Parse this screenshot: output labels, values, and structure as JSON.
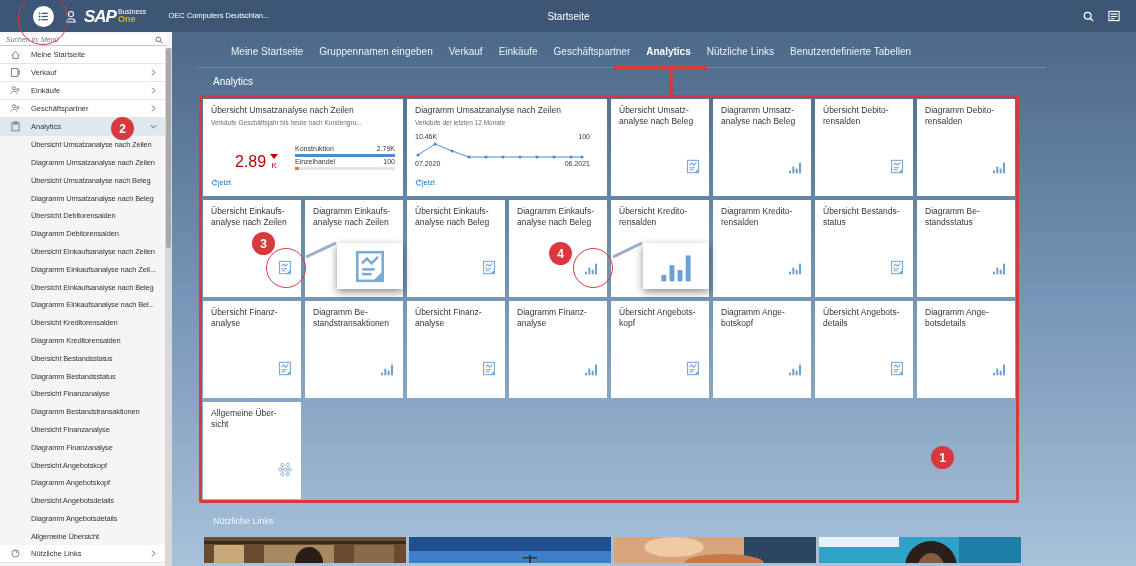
{
  "top_bar": {
    "logo": {
      "brand": "SAP",
      "line_1": "Business",
      "line_2": "One"
    },
    "company": "OEC Computers Deutschlan...",
    "title": "Startseite"
  },
  "sidebar": {
    "search": {
      "placeholder": "Suchen in: Menü"
    },
    "items": [
      {
        "label": "Meine Startseite",
        "kind": "page",
        "selected": false
      },
      {
        "label": "Verkauf",
        "kind": "group",
        "expanded": false,
        "selected": false
      },
      {
        "label": "Einkäufe",
        "kind": "group",
        "expanded": false,
        "selected": false
      },
      {
        "label": "Geschäftspartner",
        "kind": "group",
        "expanded": false,
        "selected": false
      },
      {
        "label": "Analytics",
        "kind": "group",
        "expanded": true,
        "selected": true,
        "children": [
          {
            "label": "Übersicht Umsatzanalyse nach Zeilen",
            "selected": false
          },
          {
            "label": "Diagramm Umsatzanalyse nach Zeilen",
            "selected": false
          },
          {
            "label": "Übersicht Umsatzanalyse nach Beleg",
            "selected": false
          },
          {
            "label": "Diagramm Umsatzanalyse nach Beleg",
            "selected": false
          },
          {
            "label": "Übersicht Debitorensalden",
            "selected": false
          },
          {
            "label": "Diagramm Debitorensalden",
            "selected": false
          },
          {
            "label": "Übersicht Einkaufsanalyse nach Zeilen",
            "selected": false
          },
          {
            "label": "Diagramm Einkaufsanalyse nach Zeil...",
            "selected": false
          },
          {
            "label": "Übersicht Einkaufsanalyse nach Beleg",
            "selected": false
          },
          {
            "label": "Diagramm Einkaufsanalyse nach Bel...",
            "selected": false
          },
          {
            "label": "Übersicht Kreditorensalden",
            "selected": false
          },
          {
            "label": "Diagramm Kreditorensalden",
            "selected": false
          },
          {
            "label": "Übersicht Bestandsstatus",
            "selected": false
          },
          {
            "label": "Diagramm Bestandsstatus",
            "selected": false
          },
          {
            "label": "Übersicht Finanzanalyse",
            "selected": false
          },
          {
            "label": "Diagramm Bestandstransaktionen",
            "selected": false
          },
          {
            "label": "Übersicht Finanzanalyse",
            "selected": false
          },
          {
            "label": "Diagramm Finanzanalyse",
            "selected": false
          },
          {
            "label": "Übersicht Angebotskopf",
            "selected": false
          },
          {
            "label": "Diagramm Angebotskopf",
            "selected": false
          },
          {
            "label": "Übersicht Angebotsdetails",
            "selected": false
          },
          {
            "label": "Diagramm Angebotsdetails",
            "selected": false
          },
          {
            "label": "Allgemeine Übersicht",
            "selected": false
          }
        ]
      },
      {
        "label": "Nützliche Links",
        "kind": "group",
        "expanded": false,
        "selected": false
      }
    ]
  },
  "tabs": [
    {
      "label": "Meine Startseite",
      "selected": false
    },
    {
      "label": "Gruppennamen eingeben",
      "selected": false
    },
    {
      "label": "Verkauf",
      "selected": false
    },
    {
      "label": "Einkäufe",
      "selected": false
    },
    {
      "label": "Geschäftspartner",
      "selected": false
    },
    {
      "label": "Analytics",
      "selected": true
    },
    {
      "label": "Nützliche Links",
      "selected": false
    },
    {
      "label": "Benutzerdefinierte Tabellen",
      "selected": false
    }
  ],
  "analytics": {
    "title": "Analytics",
    "tiles": [
      {
        "kind": "kpi",
        "title": "Übersicht Umsatzanalyse nach Zeilen",
        "subtitle": "Verkäufe Geschäftsjahr bis heute nach Kundengru...",
        "value": "2.89",
        "unit": "K",
        "falling": true,
        "bars": [
          {
            "label": "Konstruktion",
            "value": "2.79K",
            "level": 1,
            "color": "#4a8ccf"
          },
          {
            "label": "Einzelhandel",
            "value": "100",
            "level": 0.04,
            "color": "#e8772e"
          }
        ],
        "refresh": "jetzt"
      },
      {
        "kind": "line",
        "title": "Diagramm Umsatzanalyse nach Zeilen",
        "subtitle": "Verkäufe der letzten 12 Monate",
        "first_value": "10.46K",
        "last_value": "100",
        "start": "07.2020",
        "end": "06.2021",
        "refresh": "jetzt"
      },
      {
        "kind": "overview",
        "title": "Übersicht Umsatz-\nanalyse nach Beleg"
      },
      {
        "kind": "chart",
        "title": "Diagramm Umsatz-\nanalyse nach Beleg"
      },
      {
        "kind": "overview",
        "title": "Übersicht Debito-\nrensalden"
      },
      {
        "kind": "chart",
        "title": "Diagramm Debito-\nrensalden"
      },
      {
        "kind": "overview",
        "title": "Übersicht Einkaufs-\nanalyse nach Zeilen"
      },
      {
        "kind": "chart",
        "title": "Diagramm Einkaufs-\nanalyse nach Zeilen"
      },
      {
        "kind": "overview",
        "title": "Übersicht Einkaufs-\nanalyse nach Beleg"
      },
      {
        "kind": "chart",
        "title": "Diagramm Einkaufs-\nanalyse nach Beleg"
      },
      {
        "kind": "overview",
        "title": "Übersicht Kredito-\nrensalden"
      },
      {
        "kind": "chart",
        "title": "Diagramm Kredito-\nrensalden"
      },
      {
        "kind": "overview",
        "title": "Übersicht Bestands-\nstatus"
      },
      {
        "kind": "chart",
        "title": "Diagramm Be-\nstandsstatus"
      },
      {
        "kind": "overview",
        "title": "Übersicht Finanz-\nanalyse"
      },
      {
        "kind": "chart",
        "title": "Diagramm Be-\nstandstransaktionen"
      },
      {
        "kind": "overview",
        "title": "Übersicht Finanz-\nanalyse"
      },
      {
        "kind": "chart",
        "title": "Diagramm Finanz-\nanalyse"
      },
      {
        "kind": "overview",
        "title": "Übersicht Angebots-\nkopf"
      },
      {
        "kind": "chart",
        "title": "Diagramm Ange-\nbotskopf"
      },
      {
        "kind": "overview",
        "title": "Übersicht Angebots-\ndetails"
      },
      {
        "kind": "chart",
        "title": "Diagramm Ange-\nbotsdetails"
      },
      {
        "kind": "network",
        "title": "Allgemeine Über-\nsicht"
      }
    ]
  },
  "useful_links": {
    "title": "Nützliche Links"
  },
  "annotations": [
    {
      "number": "1"
    },
    {
      "number": "2"
    },
    {
      "number": "3"
    },
    {
      "number": "4"
    }
  ]
}
